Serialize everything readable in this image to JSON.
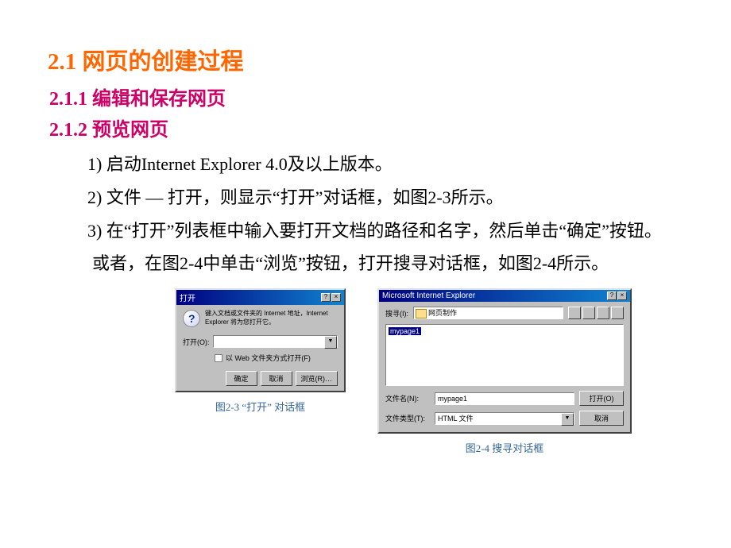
{
  "headings": {
    "h1": "2.1  网页的创建过程",
    "h2a": "2.1.1  编辑和保存网页",
    "h2b": "2.1.2  预览网页"
  },
  "body": {
    "p1": "1) 启动Internet Explorer 4.0及以上版本。",
    "p2": "2) 文件 — 打开，则显示“打开”对话框，如图2-3所示。",
    "p3": "3) 在“打开”列表框中输入要打开文档的路径和名字，然后单击“确定”按钮。",
    "p4": "或者，在图2-4中单击“浏览”按钮，打开搜寻对话框，如图2-4所示。"
  },
  "dlg_left": {
    "title": "打开",
    "help_text": "键入文档或文件夹的 Internet 地址，Internet Explorer 将为您打开它。",
    "open_label": "打开(O):",
    "open_value": "",
    "chk_label": "以 Web 文件夹方式打开(F)",
    "btn_ok": "确定",
    "btn_cancel": "取消",
    "btn_browse": "浏览(R)…",
    "caption": "图2-3  “打开” 对话框"
  },
  "dlg_right": {
    "title": "Microsoft Internet Explorer",
    "search_label": "搜寻(I):",
    "folder_value": "网页制作",
    "file_selected": "mypage1",
    "filename_label": "文件名(N):",
    "filename_value": "mypage1",
    "filetype_label": "文件类型(T):",
    "filetype_value": "HTML 文件",
    "btn_open": "打开(O)",
    "btn_cancel": "取消",
    "caption": "图2-4  搜寻对话框"
  }
}
